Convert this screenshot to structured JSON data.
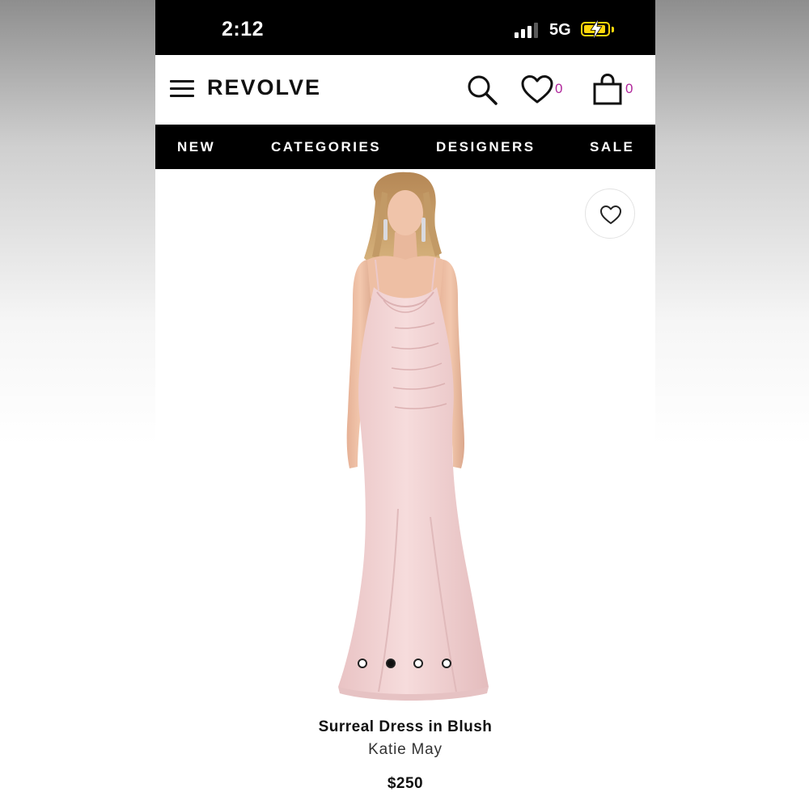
{
  "status_bar": {
    "time": "2:12",
    "network": "5G",
    "signal_bars": 3,
    "signal_bars_total": 4,
    "battery_charging": true,
    "battery_color": "#ffd60a"
  },
  "header": {
    "logo": "REVOLVE",
    "icons": [
      "menu-icon",
      "search-icon",
      "heart-icon",
      "shopping-bag-icon"
    ],
    "wishlist_count": "0",
    "bag_count": "0",
    "count_color": "#b0259b"
  },
  "nav": {
    "items": [
      {
        "label": "NEW"
      },
      {
        "label": "CATEGORIES"
      },
      {
        "label": "DESIGNERS"
      },
      {
        "label": "SALE"
      }
    ]
  },
  "gallery": {
    "image_description": "product photo of model wearing blush gown",
    "dress_color": "#f2d2d2",
    "slide_count": 4,
    "active_slide": 2
  },
  "product": {
    "name": "Surreal Dress in Blush",
    "brand": "Katie May",
    "price": "$250"
  }
}
